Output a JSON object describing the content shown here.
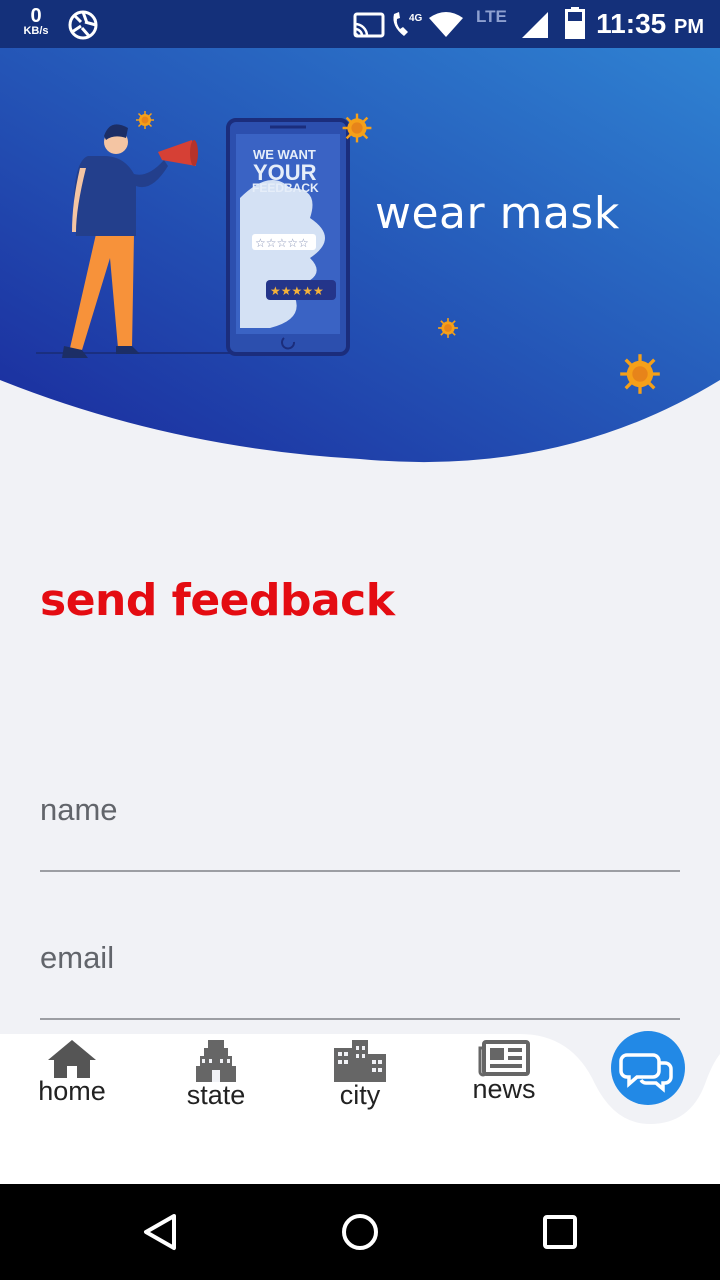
{
  "status_bar": {
    "net_speed": "0",
    "net_unit": "KB/s",
    "net_type": "4G",
    "lte": "LTE",
    "time": "11:35",
    "ampm": "PM",
    "icons": [
      "aperture-icon",
      "cast-icon",
      "wifi-call-icon",
      "wifi-icon",
      "signal-icon",
      "battery-icon"
    ]
  },
  "hero": {
    "title": "wear mask",
    "illustration_text_1": "WE WANT",
    "illustration_text_2": "YOUR",
    "illustration_text_3": "FEEDBACK",
    "colors": {
      "gradient_start": "#1a2fa0",
      "gradient_end": "#2e7cd0",
      "virus": "#f5a019"
    }
  },
  "form": {
    "heading": "send feedback",
    "heading_color": "#e40c12",
    "name_label": "name",
    "email_label": "email"
  },
  "bottom_nav": {
    "items": [
      {
        "label": "home",
        "icon": "home-icon"
      },
      {
        "label": "state",
        "icon": "temple-icon"
      },
      {
        "label": "city",
        "icon": "city-icon"
      },
      {
        "label": "news",
        "icon": "newspaper-icon"
      }
    ],
    "fab_icon": "chat-icon",
    "fab_color": "#2289e6"
  },
  "system_nav": {
    "buttons": [
      "back-icon",
      "home-circle-icon",
      "recents-icon"
    ]
  }
}
